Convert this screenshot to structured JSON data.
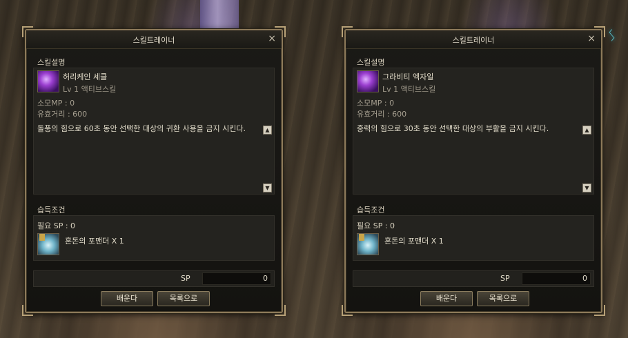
{
  "windows": [
    {
      "title": "스킬트레이너",
      "close_glyph": "×",
      "section_desc_label": "스킬설명",
      "skill_name": "허리케인 세클",
      "skill_level": "Lv 1 액티브스킬",
      "mp_cost": "소모MP  : 0",
      "range": "유효거리 : 600",
      "description": "돌풍의 힘으로 60초 동안 선택한 대상의 귀환 사용을 금지 시킨다.",
      "scroll_up": "▲",
      "scroll_down": "▼",
      "section_req_label": "습득조건",
      "required_sp": "필요 SP  :  0",
      "required_item": "혼돈의 포맨더 X 1",
      "sp_label": "SP",
      "sp_value": "0",
      "learn_button": "배운다",
      "list_button": "목록으로"
    },
    {
      "title": "스킬트레이너",
      "close_glyph": "×",
      "section_desc_label": "스킬설명",
      "skill_name": "그라비티 엑자일",
      "skill_level": "Lv 1 액티브스킬",
      "mp_cost": "소모MP  : 0",
      "range": "유효거리 : 600",
      "description": "중력의 힘으로 30초 동안 선택한 대상의 부활을 금지 시킨다.",
      "scroll_up": "▲",
      "scroll_down": "▼",
      "section_req_label": "습득조건",
      "required_sp": "필요 SP  :  0",
      "required_item": "혼돈의 포맨더 X 1",
      "sp_label": "SP",
      "sp_value": "0",
      "learn_button": "배운다",
      "list_button": "목록으로"
    }
  ],
  "colors": {
    "frame": "#8d7a5a",
    "text": "#e3ddcb",
    "muted_text": "#a7a091"
  },
  "icons": {
    "skill": "purple-magic-icon",
    "item": "pomander-crystal-icon",
    "close": "close-icon"
  }
}
